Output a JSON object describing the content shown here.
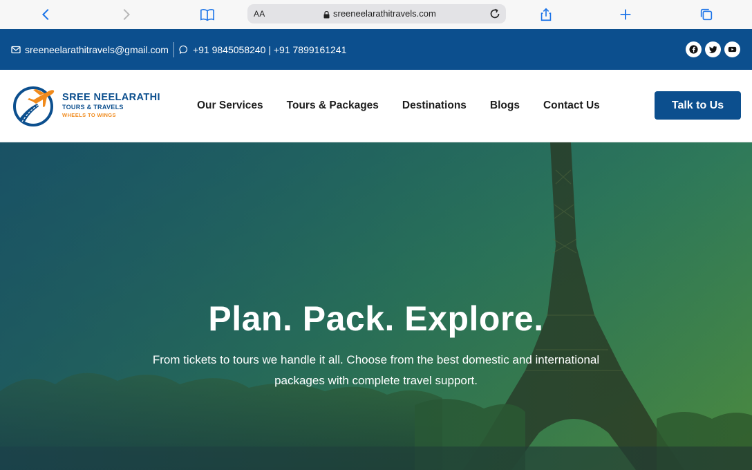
{
  "browser": {
    "url": "sreeneelarathitravels.com",
    "text_size_label": "AA"
  },
  "topbar": {
    "email": "sreeneelarathitravels@gmail.com",
    "phones": "+91 9845058240 | +91 7899161241",
    "socials": [
      "facebook-icon",
      "twitter-icon",
      "youtube-icon"
    ]
  },
  "logo": {
    "name": "SREE NEELARATHI",
    "subtitle": "TOURS & TRAVELS",
    "tagline": "WHEELS TO WINGS"
  },
  "nav": {
    "items": [
      {
        "label": "Our Services"
      },
      {
        "label": "Tours & Packages"
      },
      {
        "label": "Destinations"
      },
      {
        "label": "Blogs"
      },
      {
        "label": "Contact Us"
      }
    ],
    "cta": "Talk to Us"
  },
  "hero": {
    "title": "Plan. Pack. Explore.",
    "subtitle": "From tickets to tours we handle it all. Choose from the best domestic and international packages with complete travel support."
  },
  "colors": {
    "brand_blue": "#0c4f8e",
    "brand_orange": "#f08a1c"
  }
}
